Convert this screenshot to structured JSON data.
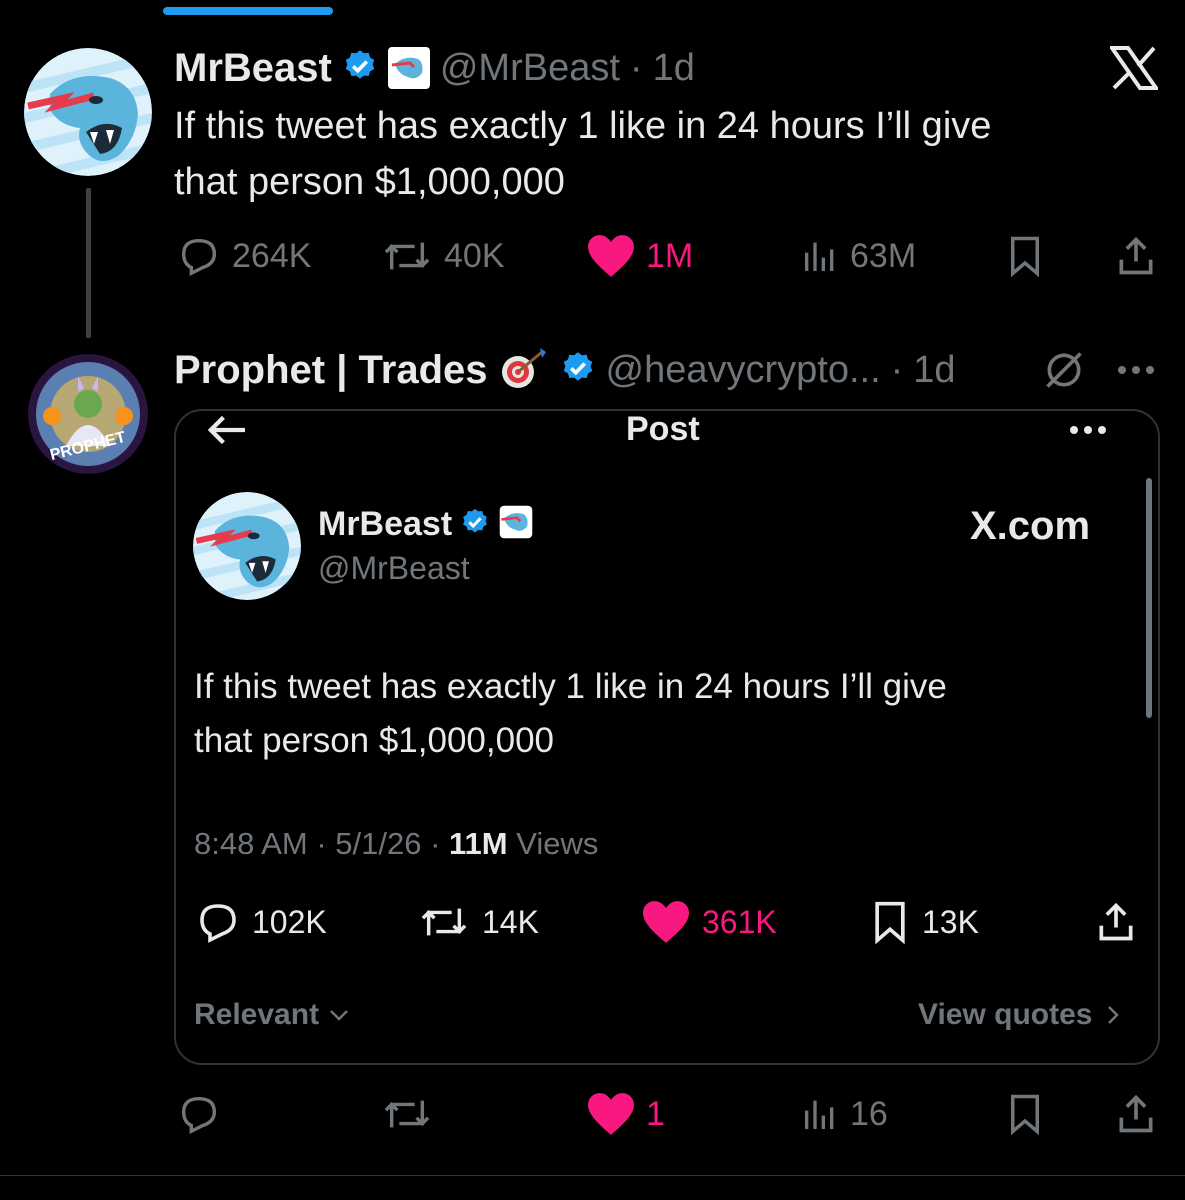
{
  "main_tweet": {
    "name": "MrBeast",
    "handle": "@MrBeast",
    "separator": "·",
    "time": "1d",
    "text_line1": "If this tweet has exactly 1 like in 24 hours I’ll give",
    "text_line2": "that person $1,000,000",
    "replies": "264K",
    "retweets": "40K",
    "likes": "1M",
    "views": "63M"
  },
  "reply_tweet": {
    "name": "Prophet | Trades",
    "handle": "@heavycrypto...",
    "separator": "·",
    "time": "1d",
    "avatar_text": "PROPHET",
    "likes": "1",
    "views": "16"
  },
  "screenshot_card": {
    "header_title": "Post",
    "name": "MrBeast",
    "handle": "@MrBeast",
    "site": "X.com",
    "text_line1": "If this tweet has exactly 1 like in 24 hours I’ll give",
    "text_line2": "that person $1,000,000",
    "meta_time": "8:48 AM · 5/1/26 · ",
    "meta_views_count": "11M",
    "meta_views_label": " Views",
    "replies": "102K",
    "retweets": "14K",
    "likes": "361K",
    "bookmarks": "13K",
    "sort_label": "Relevant",
    "view_quotes": "View quotes"
  },
  "colors": {
    "like": "#f91880",
    "verified": "#1d9bf0",
    "muted": "#71767b",
    "background": "#000000"
  },
  "icons": [
    "x-logo-icon",
    "verified-icon",
    "reply-icon",
    "retweet-icon",
    "heart-icon",
    "views-icon",
    "bookmark-icon",
    "share-icon",
    "grok-icon",
    "more-icon",
    "back-arrow-icon",
    "chevron-down-icon",
    "chevron-right-icon",
    "target-emoji-icon"
  ]
}
